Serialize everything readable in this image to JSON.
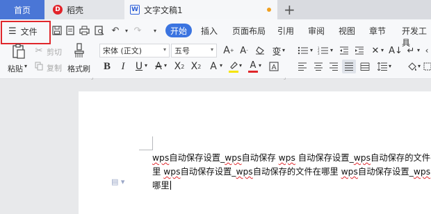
{
  "tabs": {
    "home": "首页",
    "daoke": "稻壳",
    "doc": "文字文稿1"
  },
  "toolbar": {
    "file": "文件",
    "menus": [
      "开始",
      "插入",
      "页面布局",
      "引用",
      "审阅",
      "视图",
      "章节",
      "开发工具"
    ]
  },
  "ribbon": {
    "paste": "粘贴",
    "cut": "剪切",
    "copy": "复制",
    "format_painter": "格式刷",
    "font_name": "宋体 (正文)",
    "font_size": "五号"
  },
  "document": {
    "line1_parts": [
      "wps",
      "自动保存设置",
      "_",
      "wps",
      "自动保存 ",
      "wps",
      " 自动保存设置",
      "_",
      "wps",
      "自动保存的文件在"
    ],
    "text": "wps自动保存设置_wps自动保存 wps 自动保存设置_wps自动保存的文件在哪里 wps自动保存设置_wps自动保存的文件在哪里 wps自动保存设置_wps自动保存的文件在哪里",
    "line1": "wps自动保存设置_wps自动保存 wps 自动保存设置_wps自动保存的文件在",
    "line2": "里 wps自动保存设置_wps自动保存的文件在哪里 wps自动保存设置_wps自",
    "line3": "哪里"
  },
  "colors": {
    "accent": "#3b74e0",
    "highlight_box": "#e0262b",
    "home_tab": "#4a76d6"
  }
}
